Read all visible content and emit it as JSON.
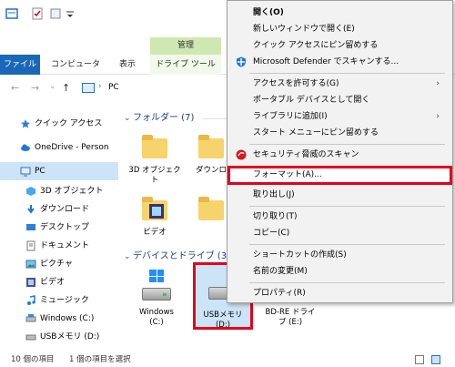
{
  "ribbon": {
    "manage_label": "管理",
    "tabs": [
      "ファイル",
      "コンピューター",
      "表示",
      "ドライブ ツール"
    ],
    "help": "?"
  },
  "address": {
    "back": "←",
    "forward": "→",
    "dropdown": "⌄",
    "up": "↑",
    "separator": "›",
    "path": "PC"
  },
  "navpane": {
    "items": [
      "クイック アクセス",
      "OneDrive - Person",
      "PC",
      "3D オブジェクト",
      "ダウンロード",
      "デスクトップ",
      "ドキュメント",
      "ピクチャ",
      "ビデオ",
      "ミュージック",
      "Windows (C:)",
      "USBメモリ (D:)"
    ]
  },
  "content": {
    "folders_header": "フォルダー (7)",
    "devices_header": "デバイスとドライブ (3)",
    "folders": [
      {
        "label1": "3D オブジェク",
        "label2": "ト"
      },
      {
        "label1": "ダウンロ",
        "label2": ""
      },
      {
        "label1": "ビデオ",
        "label2": ""
      }
    ],
    "devices": [
      {
        "label1": "Windows",
        "label2": "(C:)"
      },
      {
        "label1": "USBメモリ",
        "label2": "(D:)"
      },
      {
        "label1": "BD-RE ドライ",
        "label2": "ブ (E:)"
      }
    ]
  },
  "status": {
    "count": "10 個の項目",
    "selected": "1 個の項目を選択"
  },
  "context_menu": {
    "items": [
      "開く(O)",
      "新しいウィンドウで開く(E)",
      "クイック アクセスにピン留めする",
      "Microsoft Defender でスキャンする...",
      "アクセスを許可する(G)",
      "ポータブル デバイスとして開く",
      "ライブラリに追加(I)",
      "スタート メニューにピン留めする",
      "セキュリティ脅威のスキャン",
      "フォーマット(A)...",
      "取り出し(J)",
      "切り取り(T)",
      "コピー(C)",
      "ショートカットの作成(S)",
      "名前の変更(M)",
      "プロパティ(R)"
    ],
    "submenu_arrow": "›"
  },
  "colors": {
    "accent": "#1a67b8",
    "highlight_border": "#e3001b",
    "selection": "#cce4f7",
    "manage_tab": "#cfe8b2"
  }
}
